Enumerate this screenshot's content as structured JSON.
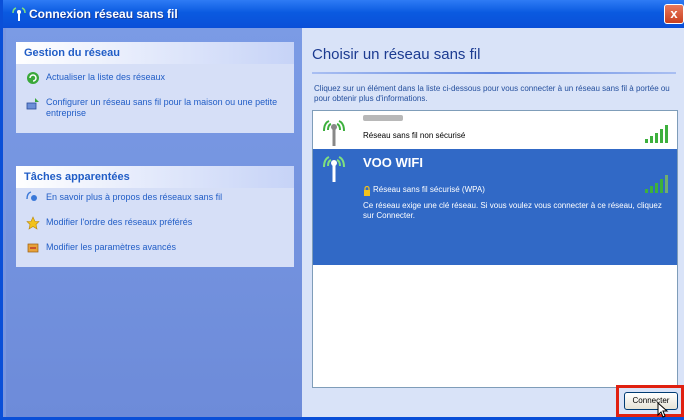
{
  "window": {
    "title": "Connexion réseau sans fil",
    "close_label": "x"
  },
  "sidebar": {
    "network_tasks": {
      "title": "Gestion du réseau",
      "items": [
        {
          "label": "Actualiser la liste des réseaux",
          "icon": "refresh-icon"
        },
        {
          "label": "Configurer un réseau sans fil pour la maison ou une petite entreprise",
          "icon": "network-setup-icon"
        }
      ]
    },
    "related_tasks": {
      "title": "Tâches apparentées",
      "items": [
        {
          "label": "En savoir plus à propos des réseaux sans fil",
          "icon": "info-icon"
        },
        {
          "label": "Modifier l'ordre des réseaux préférés",
          "icon": "star-icon"
        },
        {
          "label": "Modifier les paramètres avancés",
          "icon": "settings-icon"
        }
      ]
    }
  },
  "main": {
    "heading": "Choisir un réseau sans fil",
    "instructions": "Cliquez sur un élément dans la liste ci-dessous pour vous connecter à un réseau sans fil à portée ou pour obtenir plus d'informations.",
    "networks": [
      {
        "ssid": "",
        "security": "Réseau sans fil non sécurisé",
        "signal": 5,
        "selected": false
      },
      {
        "ssid": "VOO WIFI",
        "security": "Réseau sans fil sécurisé (WPA)",
        "description": "Ce réseau exige une clé réseau. Si vous voulez vous connecter à ce réseau, cliquez sur Connecter.",
        "signal": 4,
        "selected": true
      }
    ],
    "connect_label": "Connecter"
  },
  "colors": {
    "titlebar": "#0a5ae0",
    "selection": "#3169c6",
    "highlight": "#e02010",
    "signal": "#3db03d"
  }
}
